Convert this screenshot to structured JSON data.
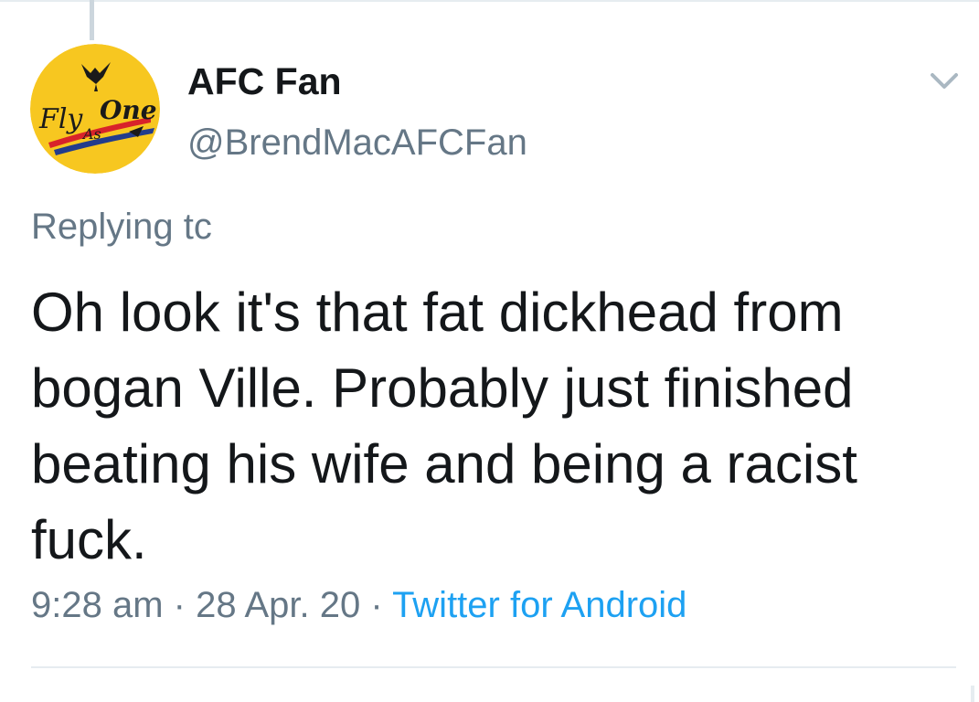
{
  "tweet": {
    "author": {
      "name": "AFC Fan",
      "handle": "@BrendMacAFCFan",
      "avatar_text_top": "Fly",
      "avatar_text_mid": "As",
      "avatar_text_right": "One"
    },
    "reply_prefix": "Replying tc",
    "text": "Oh look it's that fat dickhead from bogan Ville. Probably just finished beating his wife and being a racist fuck.",
    "time": "9:28 am",
    "separator": " · ",
    "date": "28 Apr. 20",
    "source": "Twitter for Android"
  },
  "icons": {
    "menu": "chevron-down-icon",
    "avatar": "fly-as-one-logo"
  },
  "colors": {
    "primary_text": "#14171a",
    "secondary_text": "#657786",
    "link": "#1da1f2",
    "avatar_yellow": "#f7c720",
    "divider": "#e6ecf0"
  }
}
